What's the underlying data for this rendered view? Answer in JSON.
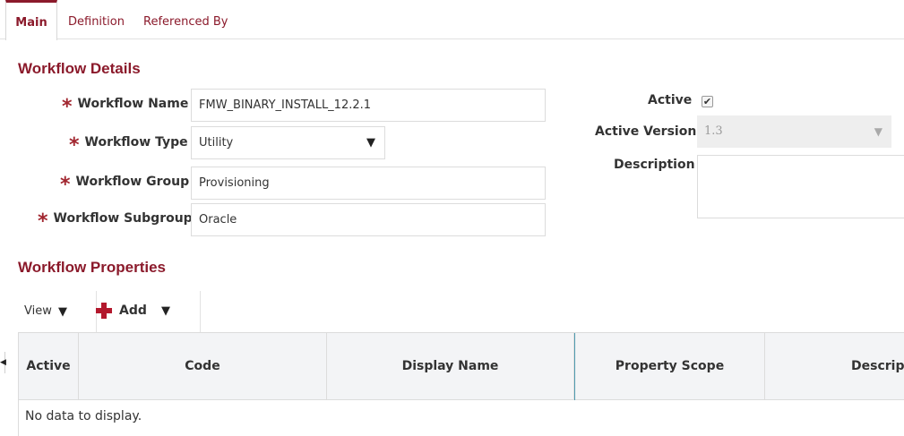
{
  "tabs": [
    {
      "label": "Main"
    },
    {
      "label": "Definition"
    },
    {
      "label": "Referenced By"
    }
  ],
  "details": {
    "title": "Workflow Details",
    "required_mark": "*",
    "name_label": "Workflow Name",
    "name_value": "FMW_BINARY_INSTALL_12.2.1",
    "type_label": "Workflow Type",
    "type_value": "Utility",
    "group_label": "Workflow Group",
    "group_value": "Provisioning",
    "subgroup_label": "Workflow Subgroup",
    "subgroup_value": "Oracle",
    "active_label": "Active",
    "active_checked": true,
    "active_version_label": "Active Version",
    "active_version_value": "1.3",
    "description_label": "Description",
    "description_value": ""
  },
  "properties": {
    "title": "Workflow Properties",
    "view_label": "View",
    "add_label": "Add",
    "columns": [
      "Active",
      "Code",
      "Display Name",
      "Property Scope",
      "Descripti"
    ],
    "empty_text": "No data to display."
  },
  "icons": {
    "dropdown": "triangle-down-icon",
    "add": "plus-icon",
    "check": "checkmark-icon",
    "collapse": "triangle-left-icon"
  },
  "colors": {
    "accent": "#8b1a2b",
    "add_icon": "#b3182d",
    "table_header_bg": "#f3f4f6",
    "selected_col_border": "#4e9bb0"
  }
}
